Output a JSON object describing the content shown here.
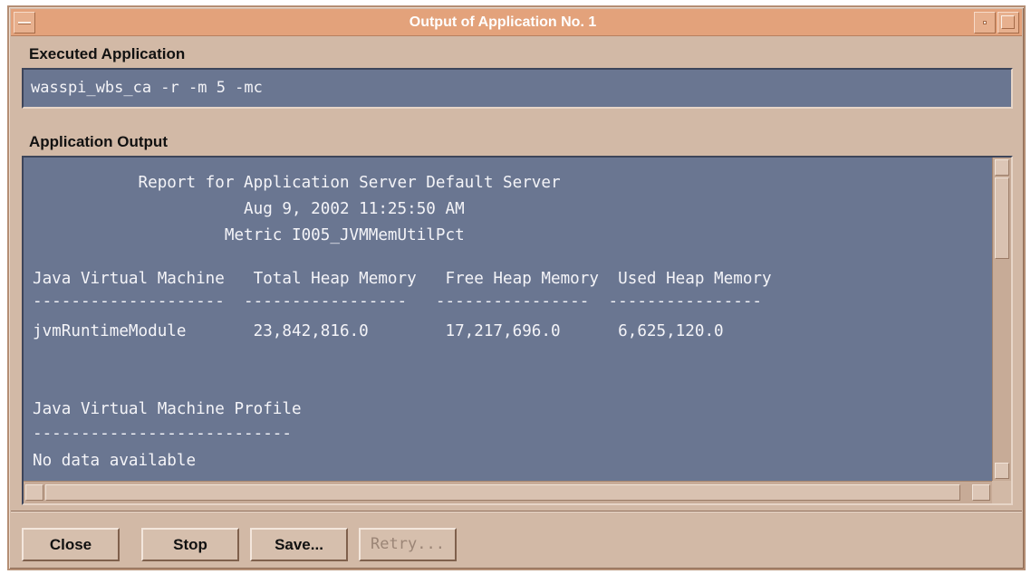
{
  "window": {
    "title": "Output of Application No. 1"
  },
  "executed": {
    "label": "Executed Application",
    "command": "wasspi_wbs_ca -r -m 5 -mc"
  },
  "output": {
    "label": "Application Output",
    "lines": [
      "           Report for Application Server Default Server",
      "                      Aug 9, 2002 11:25:50 AM",
      "                    Metric I005_JVMMemUtilPct",
      "Java Virtual Machine   Total Heap Memory   Free Heap Memory  Used Heap Memory",
      "--------------------  -----------------   ----------------  ----------------",
      "jvmRuntimeModule       23,842,816.0        17,217,696.0      6,625,120.0",
      "Java Virtual Machine Profile",
      "---------------------------",
      "No data available"
    ]
  },
  "buttons": {
    "close": "Close",
    "stop": "Stop",
    "save": "Save...",
    "retry": "Retry..."
  },
  "colors": {
    "window_bg": "#d2b9a6",
    "titlebar": "#e3a27b",
    "text_area_bg": "#6a7691",
    "text_area_fg": "#f4f4f8"
  },
  "icons": [
    "window-menu-icon",
    "minimize-icon",
    "maximize-icon",
    "scroll-up-arrow-icon",
    "scroll-down-arrow-icon",
    "scroll-left-arrow-icon",
    "scroll-right-arrow-icon"
  ]
}
